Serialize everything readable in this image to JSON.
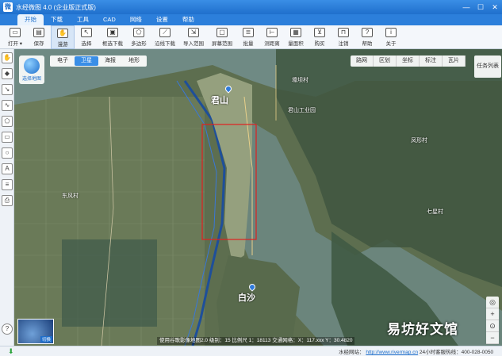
{
  "window": {
    "title": "水经微图 4.0 (企业版正式版)",
    "logo_text": "微",
    "controls": [
      "—",
      "☐",
      "✕"
    ]
  },
  "menu": {
    "items": [
      {
        "label": "开始",
        "active": true
      },
      {
        "label": "下载",
        "active": false
      },
      {
        "label": "工具",
        "active": false
      },
      {
        "label": "CAD",
        "active": false
      },
      {
        "label": "网络",
        "active": false
      },
      {
        "label": "设置",
        "active": false
      },
      {
        "label": "帮助",
        "active": false
      }
    ]
  },
  "toolbar": {
    "items": [
      {
        "label": "打开 ▾",
        "icon": "folder-icon",
        "glyph": "▭",
        "active": false
      },
      {
        "label": "保存",
        "icon": "save-icon",
        "glyph": "▤",
        "active": false
      },
      {
        "label": "漫游",
        "icon": "hand-icon",
        "glyph": "✋",
        "active": true
      },
      {
        "label": "选择",
        "icon": "cursor-icon",
        "glyph": "↖",
        "active": false
      },
      {
        "label": "框选下载",
        "icon": "box-download-icon",
        "glyph": "▣",
        "active": false
      },
      {
        "label": "多边形",
        "icon": "polygon-icon",
        "glyph": "⬠",
        "active": false
      },
      {
        "label": "沿线下载",
        "icon": "line-download-icon",
        "glyph": "⟋",
        "active": false
      },
      {
        "label": "导入范围",
        "icon": "import-range-icon",
        "glyph": "⇲",
        "active": false
      },
      {
        "label": "屏幕范围",
        "icon": "screen-range-icon",
        "glyph": "▢",
        "active": false
      },
      {
        "label": "批量",
        "icon": "batch-icon",
        "glyph": "≣",
        "active": false
      },
      {
        "label": "测距离",
        "icon": "measure-distance-icon",
        "glyph": "⊢",
        "active": false
      },
      {
        "label": "量面积",
        "icon": "measure-area-icon",
        "glyph": "▦",
        "active": false
      },
      {
        "label": "购买",
        "icon": "cart-icon",
        "glyph": "⊻",
        "active": false
      },
      {
        "label": "注销",
        "icon": "lock-icon",
        "glyph": "⊓",
        "active": false
      },
      {
        "label": "帮助",
        "icon": "help-icon",
        "glyph": "?",
        "active": false
      },
      {
        "label": "关于",
        "icon": "info-icon",
        "glyph": "i",
        "active": false
      }
    ]
  },
  "sidebar": {
    "items": [
      {
        "icon": "pan-icon",
        "glyph": "✋"
      },
      {
        "icon": "marker-icon",
        "glyph": "◆"
      },
      {
        "icon": "line-icon",
        "glyph": "↘"
      },
      {
        "icon": "polyline-icon",
        "glyph": "∿"
      },
      {
        "icon": "polygon-draw-icon",
        "glyph": "⬠"
      },
      {
        "icon": "rectangle-icon",
        "glyph": "▭"
      },
      {
        "icon": "circle-icon",
        "glyph": "○"
      },
      {
        "icon": "text-icon",
        "glyph": "A"
      },
      {
        "icon": "layers-icon",
        "glyph": "≡"
      },
      {
        "icon": "print-icon",
        "glyph": "⎙"
      }
    ],
    "help_glyph": "?"
  },
  "map": {
    "source_label": "选择地图",
    "type_tabs": [
      {
        "label": "电子",
        "active": false
      },
      {
        "label": "卫星",
        "active": true
      },
      {
        "label": "海报",
        "active": false
      },
      {
        "label": "地形",
        "active": false
      }
    ],
    "right_tools": [
      "路网",
      "区划",
      "坐标",
      "标注",
      "瓦片"
    ],
    "task_button": "任务列表",
    "zoom_controls": [
      "◎",
      "+",
      "⊙",
      "−"
    ],
    "minimap_label": "切换",
    "place_labels": [
      {
        "text": "君山",
        "big": true
      },
      {
        "text": "白沙",
        "big": true
      },
      {
        "text": "壕坝村",
        "big": false
      },
      {
        "text": "君山工业园",
        "big": false
      },
      {
        "text": "东风村",
        "big": false
      },
      {
        "text": "凤形村",
        "big": false
      },
      {
        "text": "七星村",
        "big": false
      }
    ],
    "scale_text": "使用谷歌影像地图2.0  级别：15  比例尺 1：18113      交通网格：X：117.xxx  Y：30.4820",
    "watermark": "易坊好文馆"
  },
  "statusbar": {
    "download_glyph": "⬇",
    "site_text": "水经网站：",
    "site_link": "http://www.rivermap.cn",
    "hotline": "24小时客服热线：400-028-0050"
  }
}
